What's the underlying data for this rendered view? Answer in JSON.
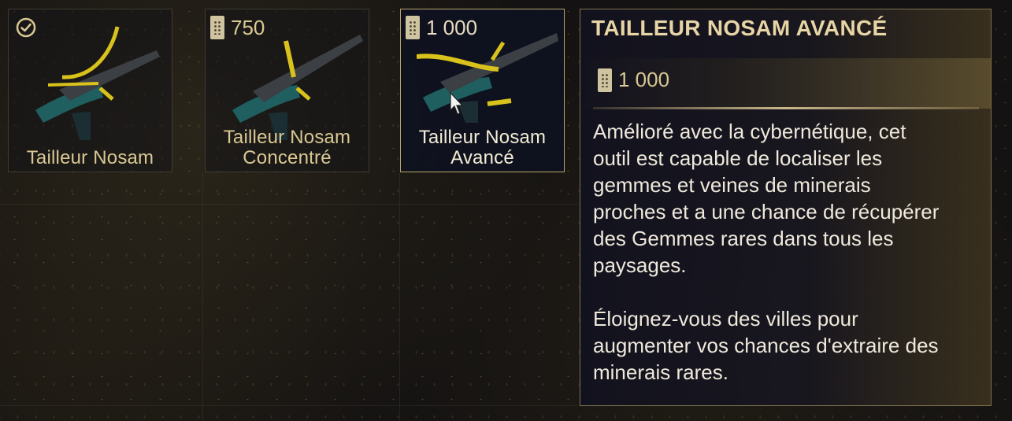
{
  "items": [
    {
      "name": "Tailleur Nosam",
      "owned": true,
      "icon": "check-circle-icon"
    },
    {
      "name": "Tailleur Nosam\nConcentré",
      "price": "750",
      "icon": "standing-badge-icon"
    },
    {
      "name": "Tailleur Nosam\nAvancé",
      "price": "1 000",
      "icon": "standing-badge-icon",
      "selected": true
    }
  ],
  "detail": {
    "title": "TAILLEUR NOSAM AVANCÉ",
    "price": "1 000",
    "description": "Amélioré avec la cybernétique, cet\noutil est capable de localiser les\ngemmes et veines de minerais\nproches et a une chance de récupérer\ndes Gemmes rares dans tous les\npaysages.\n\nÉloignez-vous des villes pour\naugmenter vos chances d'extraire des\nminerais rares."
  },
  "colors": {
    "accent_gold": "#d9c893",
    "selected_border": "#b9a56f",
    "weapon_teal": "#1f5f60",
    "weapon_yellow": "#d8c21b"
  }
}
